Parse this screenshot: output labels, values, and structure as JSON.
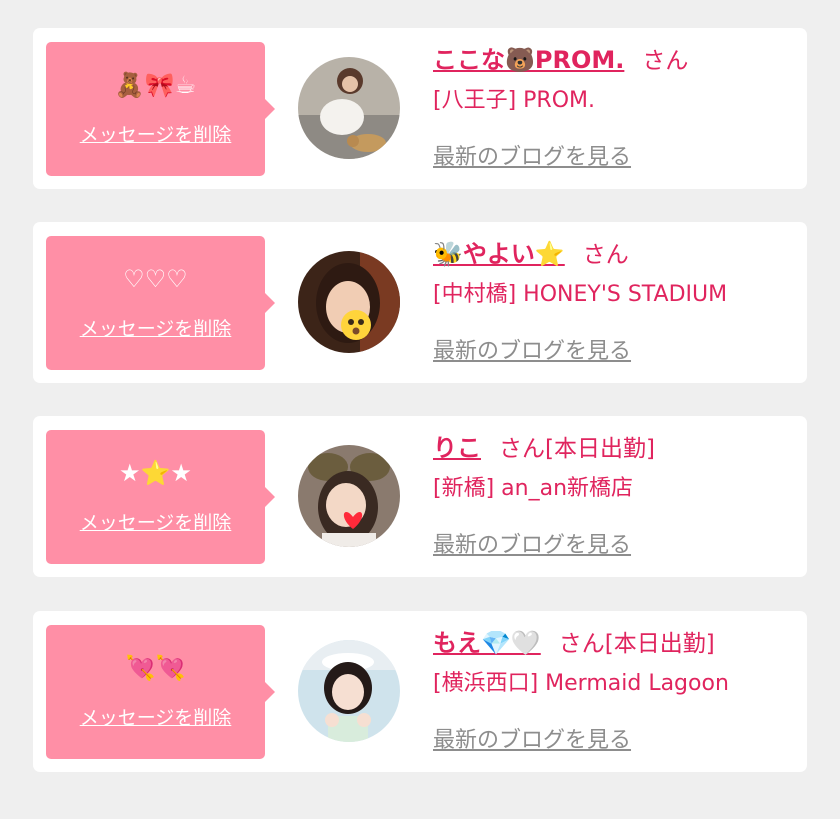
{
  "cards": [
    {
      "message": "🧸🎀☕",
      "delete_label": "メッセージを削除",
      "name": "ここな🐻PROM.",
      "honorific": "さん",
      "shop": "[八王子] PROM.",
      "blog_link": "最新のブログを見る"
    },
    {
      "message": "♡♡♡",
      "delete_label": "メッセージを削除",
      "name": "🐝やよい⭐",
      "honorific": "さん",
      "shop": "[中村橋] HONEY'S STADIUM",
      "blog_link": "最新のブログを見る"
    },
    {
      "message": "★⭐★",
      "delete_label": "メッセージを削除",
      "name": "りこ",
      "honorific": "さん[本日出勤]",
      "shop": "[新橋] an_an新橋店",
      "blog_link": "最新のブログを見る"
    },
    {
      "message": "💘💘",
      "delete_label": "メッセージを削除",
      "name": "もえ💎🤍",
      "honorific": "さん[本日出勤]",
      "shop": "[横浜西口] Mermaid Lagoon",
      "blog_link": "最新のブログを見る"
    }
  ],
  "colors": {
    "accent": "#e0245e",
    "bubble": "#ff8fa6",
    "link_gray": "#8d8d8d",
    "background": "#efefef"
  }
}
